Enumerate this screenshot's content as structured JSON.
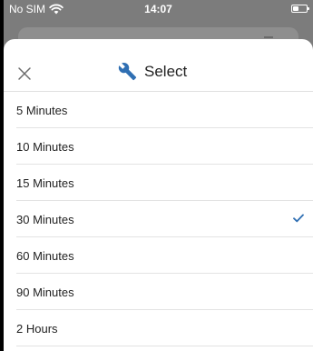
{
  "status_bar": {
    "carrier": "No SIM",
    "wifi_icon": "wifi-icon",
    "time": "14:07",
    "battery_icon": "battery-icon"
  },
  "sheet": {
    "close_icon": "close-icon",
    "title_icon": "wrench-icon",
    "title": "Select",
    "accent_color": "#2f6fb3"
  },
  "options": [
    {
      "label": "5 Minutes",
      "selected": false
    },
    {
      "label": "10 Minutes",
      "selected": false
    },
    {
      "label": "15 Minutes",
      "selected": false
    },
    {
      "label": "30 Minutes",
      "selected": true
    },
    {
      "label": "60 Minutes",
      "selected": false
    },
    {
      "label": "90 Minutes",
      "selected": false
    },
    {
      "label": "2 Hours",
      "selected": false
    }
  ],
  "selected_check_icon": "checkmark-icon"
}
